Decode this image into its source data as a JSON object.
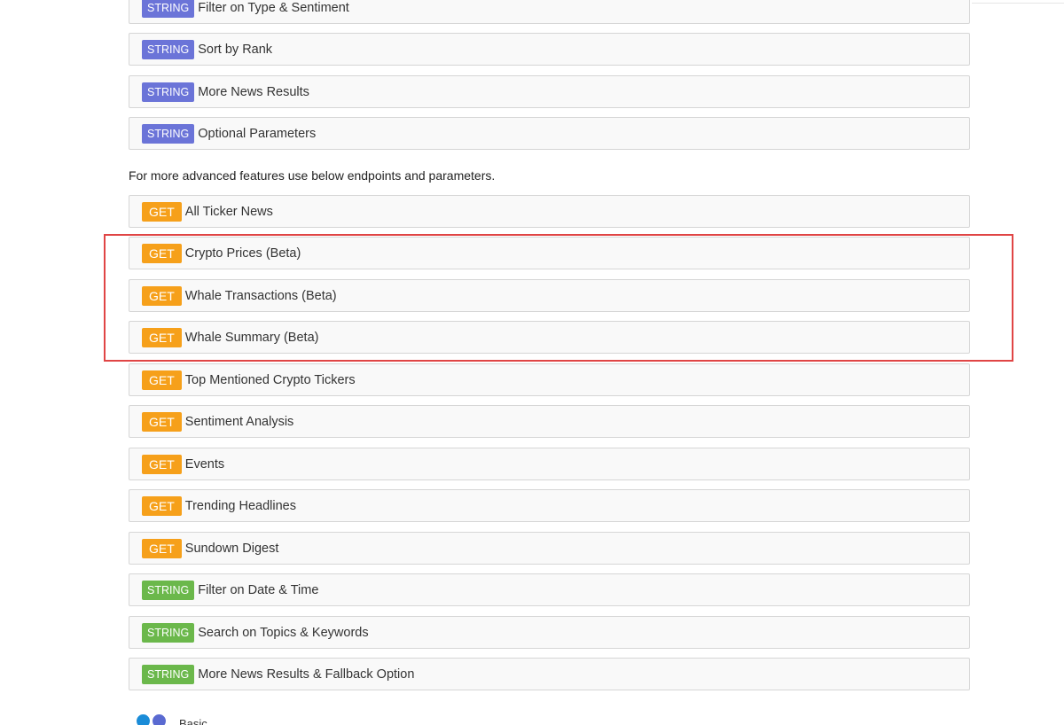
{
  "intro_text": "For more advanced features use below endpoints and parameters.",
  "string_endpoints_top": [
    {
      "method": "STRING",
      "label": "Filter on Type & Sentiment"
    },
    {
      "method": "STRING",
      "label": "Sort by Rank"
    },
    {
      "method": "STRING",
      "label": "More News Results"
    },
    {
      "method": "STRING",
      "label": "Optional Parameters"
    }
  ],
  "advanced_endpoints": [
    {
      "method": "GET",
      "label": "All Ticker News"
    },
    {
      "method": "GET",
      "label": "Crypto Prices (Beta)"
    },
    {
      "method": "GET",
      "label": "Whale Transactions (Beta)"
    },
    {
      "method": "GET",
      "label": "Whale Summary (Beta)"
    },
    {
      "method": "GET",
      "label": "Top Mentioned Crypto Tickers"
    },
    {
      "method": "GET",
      "label": "Sentiment Analysis"
    },
    {
      "method": "GET",
      "label": "Events"
    },
    {
      "method": "GET",
      "label": "Trending Headlines"
    },
    {
      "method": "GET",
      "label": "Sundown Digest"
    },
    {
      "method": "STRING",
      "label": "Filter on Date & Time"
    },
    {
      "method": "STRING",
      "label": "Search on Topics & Keywords"
    },
    {
      "method": "STRING",
      "label": "More News Results & Fallback Option"
    }
  ],
  "footer": {
    "label": "Basic"
  },
  "colors": {
    "string_blue": "#6b74d8",
    "string_green": "#6bb84b",
    "get_orange": "#f6a01a",
    "highlight_red": "#e04545"
  }
}
